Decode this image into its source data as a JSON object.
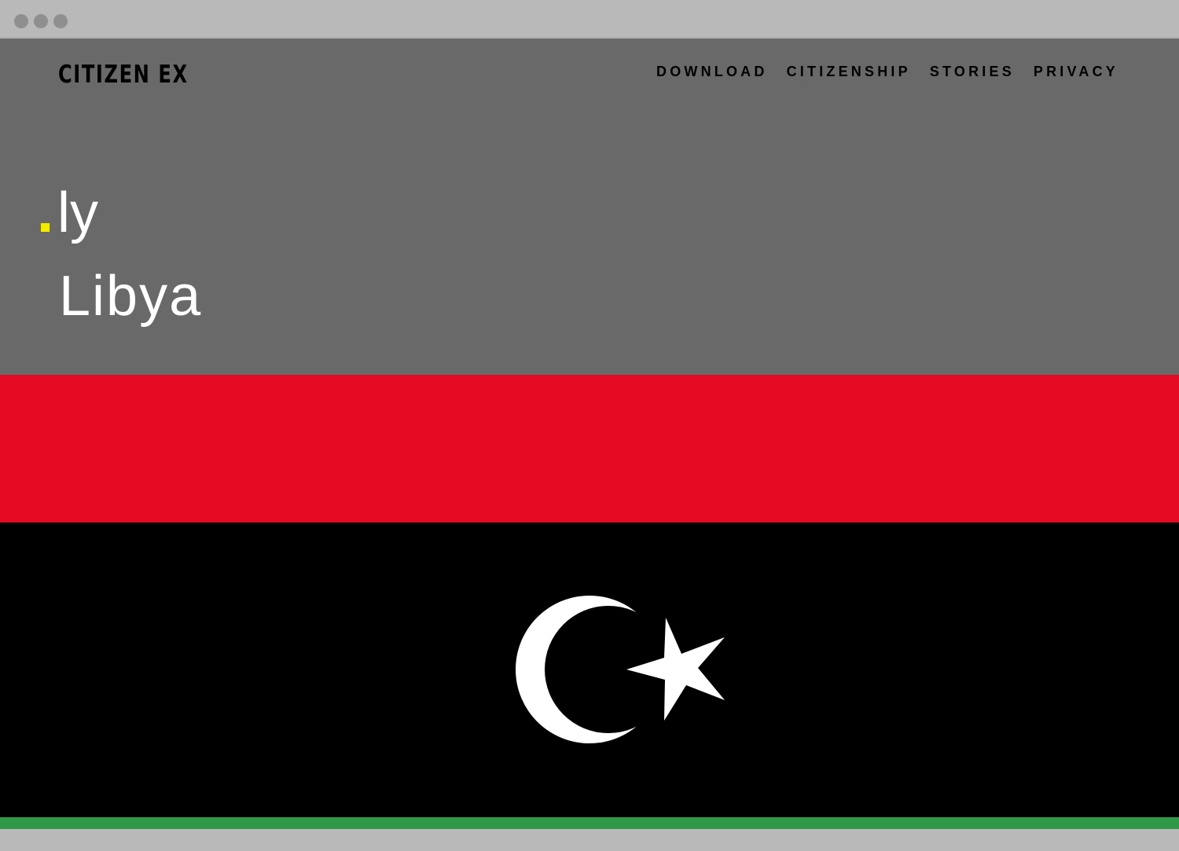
{
  "site": {
    "logo_text": "CITIZEN EX"
  },
  "nav": {
    "items": [
      {
        "label": "DOWNLOAD"
      },
      {
        "label": "CITIZENSHIP"
      },
      {
        "label": "STORIES"
      },
      {
        "label": "PRIVACY"
      }
    ]
  },
  "country": {
    "tld": "ly",
    "name": "Libya"
  },
  "colors": {
    "chrome": "#b9b9b9",
    "header_band": "#696969",
    "flag_red": "#e30a22",
    "flag_black": "#000000",
    "flag_green": "#2e9a48",
    "accent_dot": "#f2ec00"
  },
  "icons": {
    "emblem": "crescent-and-star-icon"
  }
}
